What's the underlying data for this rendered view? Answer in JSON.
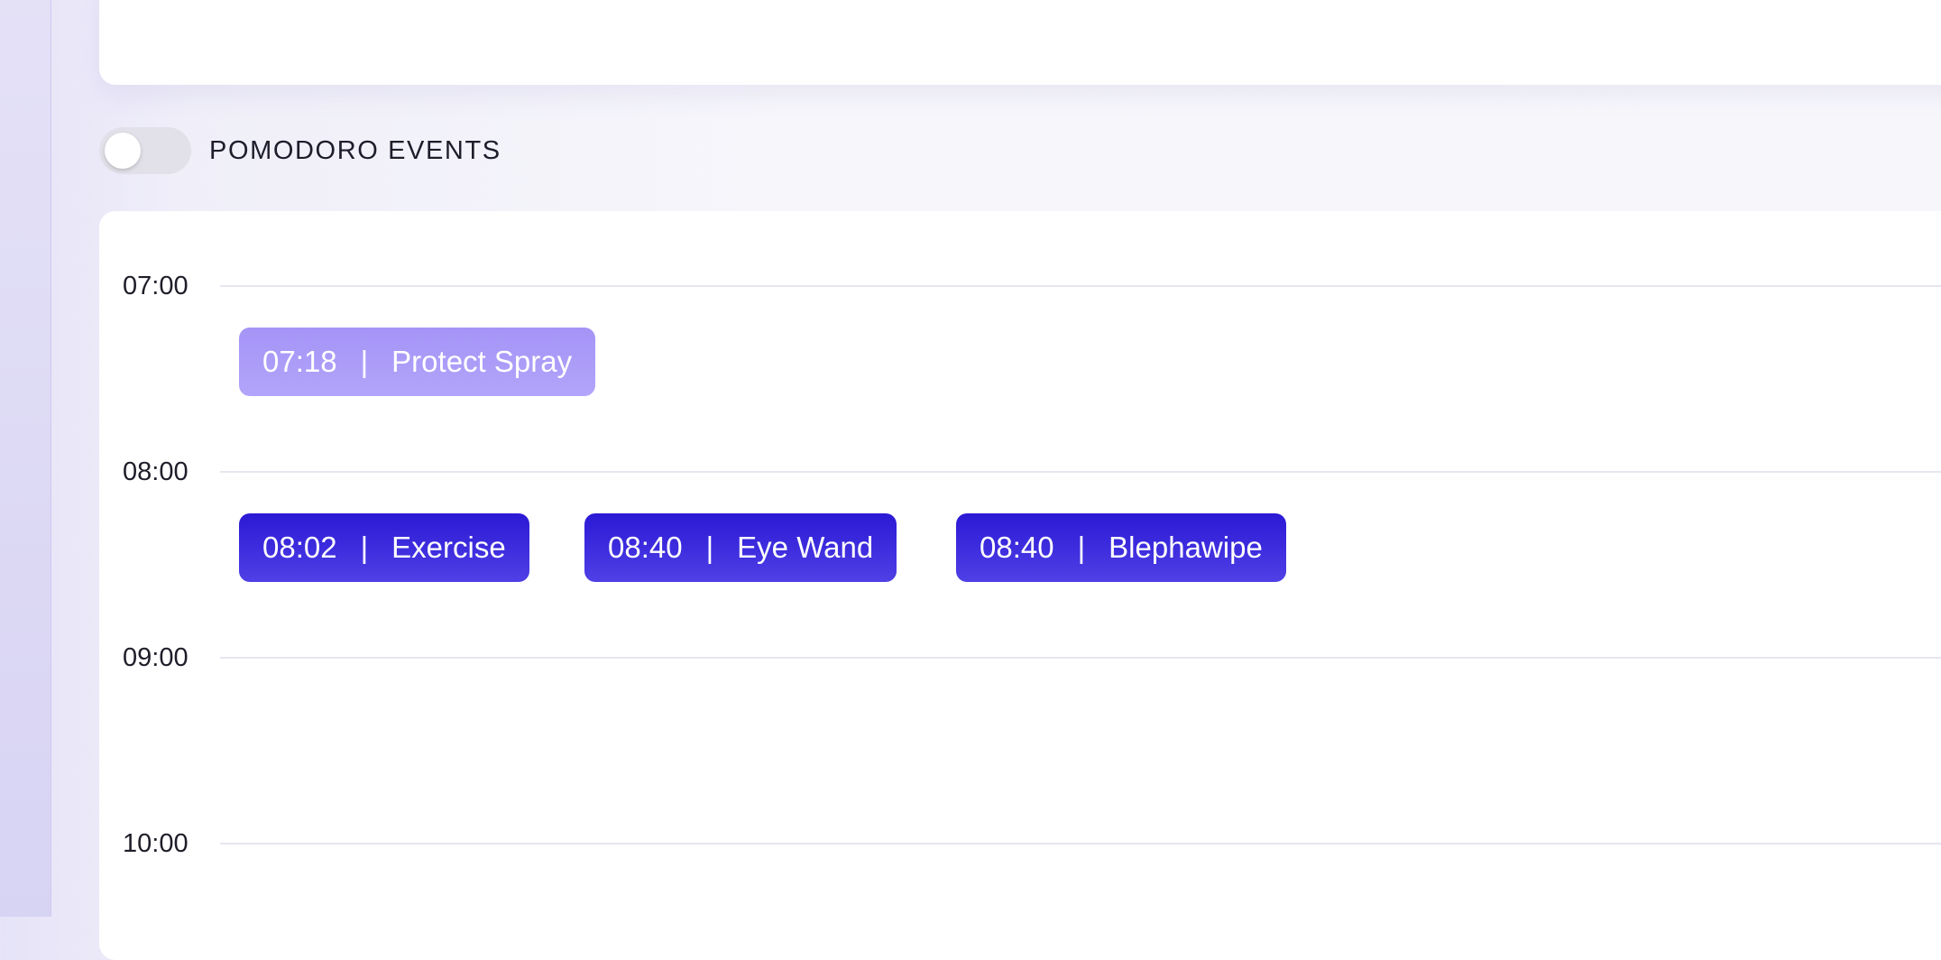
{
  "pomodoro_toggle": {
    "label": "POMODORO EVENTS",
    "enabled": false
  },
  "timeline": {
    "hours": [
      "07:00",
      "08:00",
      "09:00",
      "10:00"
    ],
    "separator": "|",
    "events": [
      {
        "time": "07:18",
        "title": "Protect Spray",
        "style": "light"
      },
      {
        "time": "08:02",
        "title": "Exercise",
        "style": "dark"
      },
      {
        "time": "08:40",
        "title": "Eye Wand",
        "style": "dark"
      },
      {
        "time": "08:40",
        "title": "Blephawipe",
        "style": "dark"
      }
    ]
  },
  "colors": {
    "event_light": "#a594f6",
    "event_dark": "#2b19d5",
    "toggle_off": "#e2e1e9"
  }
}
